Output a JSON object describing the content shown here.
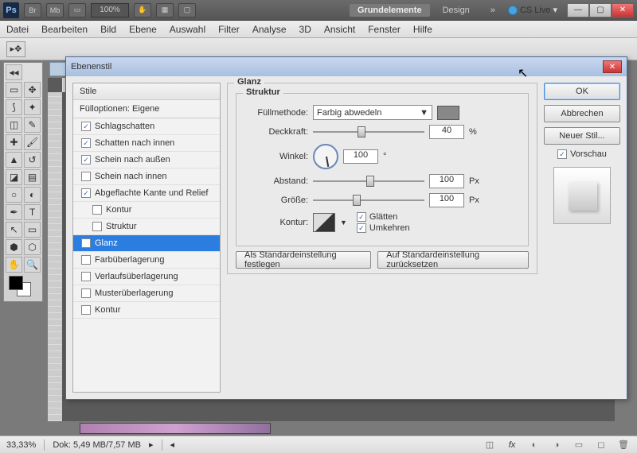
{
  "appbar": {
    "zoom": "100%",
    "ws_active": "Grundelemente",
    "ws_other": "Design",
    "cslive": "CS Live"
  },
  "menu": [
    "Datei",
    "Bearbeiten",
    "Bild",
    "Ebene",
    "Auswahl",
    "Filter",
    "Analyse",
    "3D",
    "Ansicht",
    "Fenster",
    "Hilfe"
  ],
  "status": {
    "zoom": "33,33%",
    "doc": "Dok: 5,49 MB/7,57 MB"
  },
  "dialog": {
    "title": "Ebenenstil",
    "styles_header": "Stile",
    "fill_opts": "Fülloptionen: Eigene",
    "items": [
      {
        "label": "Schlagschatten",
        "checked": true
      },
      {
        "label": "Schatten nach innen",
        "checked": true
      },
      {
        "label": "Schein nach außen",
        "checked": true
      },
      {
        "label": "Schein nach innen",
        "checked": false
      },
      {
        "label": "Abgeflachte Kante und Relief",
        "checked": true
      },
      {
        "label": "Kontur",
        "checked": false,
        "sub": true
      },
      {
        "label": "Struktur",
        "checked": false,
        "sub": true
      },
      {
        "label": "Glanz",
        "checked": true,
        "selected": true
      },
      {
        "label": "Farbüberlagerung",
        "checked": false
      },
      {
        "label": "Verlaufsüberlagerung",
        "checked": false
      },
      {
        "label": "Musterüberlagerung",
        "checked": false
      },
      {
        "label": "Kontur",
        "checked": false
      }
    ],
    "section": "Glanz",
    "struct": "Struktur",
    "blend_label": "Füllmethode:",
    "blend_value": "Farbig abwedeln",
    "opacity_label": "Deckkraft:",
    "opacity_value": "40",
    "opacity_unit": "%",
    "angle_label": "Winkel:",
    "angle_value": "100",
    "angle_unit": "°",
    "distance_label": "Abstand:",
    "distance_value": "100",
    "distance_unit": "Px",
    "size_label": "Größe:",
    "size_value": "100",
    "size_unit": "Px",
    "contour_label": "Kontur:",
    "smooth": "Glätten",
    "invert": "Umkehren",
    "btn_default": "Als Standardeinstellung festlegen",
    "btn_reset": "Auf Standardeinstellung zurücksetzen",
    "ok": "OK",
    "cancel": "Abbrechen",
    "newstyle": "Neuer Stil...",
    "preview": "Vorschau"
  }
}
